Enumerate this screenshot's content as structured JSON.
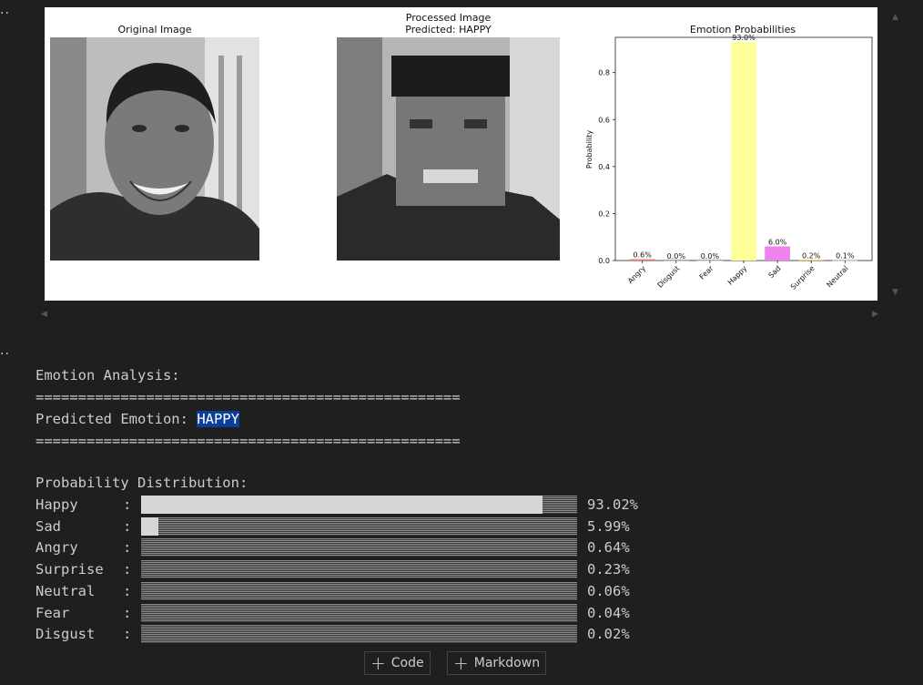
{
  "figure": {
    "original_title": "Original Image",
    "processed_title_line1": "Processed Image",
    "processed_title_line2": "Predicted: HAPPY",
    "chart_title": "Emotion Probabilities"
  },
  "chart_data": {
    "type": "bar",
    "title": "Emotion Probabilities",
    "xlabel": "",
    "ylabel": "Probability",
    "ylim": [
      0,
      0.95
    ],
    "yticks": [
      "0.0",
      "0.2",
      "0.4",
      "0.6",
      "0.8"
    ],
    "categories": [
      "Angry",
      "Disgust",
      "Fear",
      "Happy",
      "Sad",
      "Surprise",
      "Neutral"
    ],
    "values": [
      0.006,
      0.0,
      0.0,
      0.93,
      0.06,
      0.002,
      0.001
    ],
    "data_labels": [
      "0.6%",
      "0.0%",
      "0.0%",
      "93.0%",
      "6.0%",
      "0.2%",
      "0.1%"
    ],
    "colors": [
      "#f08080",
      "#8fbc8f",
      "#add8e6",
      "#ffff99",
      "#ee82ee",
      "#ffa500",
      "#d3d3d3"
    ],
    "grid": false,
    "legend": "none"
  },
  "output": {
    "header": "Emotion Analysis:",
    "separator": "==================================================",
    "predicted_label": "Predicted Emotion: ",
    "predicted_value": "HAPPY",
    "distribution_header": "Probability Distribution:",
    "rows": [
      {
        "label": "Happy",
        "pct": "93.02%",
        "fraction": 0.9302
      },
      {
        "label": "Sad",
        "pct": "5.99%",
        "fraction": 0.0599
      },
      {
        "label": "Angry",
        "pct": "0.64%",
        "fraction": 0.0064
      },
      {
        "label": "Surprise",
        "pct": "0.23%",
        "fraction": 0.0023
      },
      {
        "label": "Neutral",
        "pct": "0.06%",
        "fraction": 0.0006
      },
      {
        "label": "Fear",
        "pct": "0.04%",
        "fraction": 0.0004
      },
      {
        "label": "Disgust",
        "pct": "0.02%",
        "fraction": 0.0002
      }
    ]
  },
  "toolbar": {
    "add_code_label": "Code",
    "add_markdown_label": "Markdown"
  },
  "colors": {
    "background": "#1f1f1f",
    "text": "#cccccc",
    "highlight": "#0b3f9a",
    "bar_fill": "#d6d6d9"
  }
}
